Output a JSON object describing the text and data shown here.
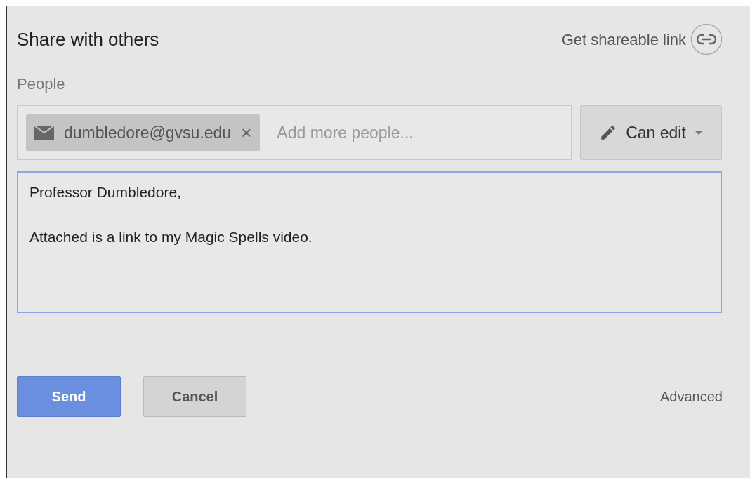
{
  "dialog": {
    "title": "Share with others",
    "shareable_link": "Get shareable link"
  },
  "people": {
    "label": "People",
    "recipients": [
      {
        "email": "dumbledore@gvsu.edu",
        "remove": "×"
      }
    ],
    "placeholder": "Add more people...",
    "permission": "Can edit"
  },
  "message": {
    "value": "Professor Dumbledore,\n\nAttached is a link to my Magic Spells video."
  },
  "buttons": {
    "send": "Send",
    "cancel": "Cancel",
    "advanced": "Advanced"
  }
}
